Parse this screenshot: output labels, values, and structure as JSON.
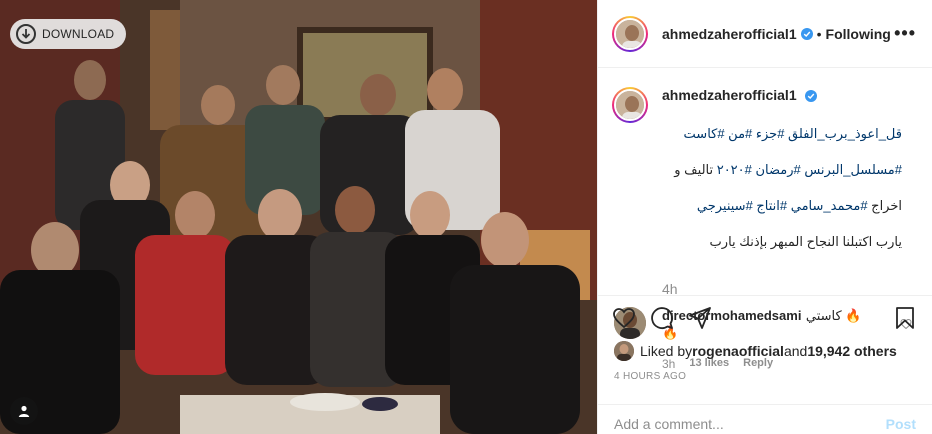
{
  "photo": {
    "download_label": "DOWNLOAD",
    "download_icon": "download-icon",
    "user_tag_icon": "user-tag-icon"
  },
  "header": {
    "username": "ahmedzaherofficial1",
    "separator": "•",
    "follow_status": "Following",
    "more_label": "•••"
  },
  "caption": {
    "username": "ahmedzaherofficial1",
    "line1_a": "قل_اعوذ_برب_الفلق ",
    "line1_tags": "#جزء #من #كاست",
    "line2_tags": "#مسلسل_البرنس #رمضان #٢٠٢٠",
    "line2_b": " تاليف و",
    "line3_a": "اخراج ",
    "line3_tags": "#محمد_سامي #انتاج #سينيرجي",
    "line4": "يارب اكتبلنا النجاح المبهر بإذنك يارب",
    "time": "4h"
  },
  "comment": {
    "username": "directormohamedsami",
    "text": "كاستي 🔥",
    "text2": "🔥",
    "time": "3h",
    "likes": "13 likes",
    "reply": "Reply"
  },
  "likes": {
    "prefix": "Liked by ",
    "user": "rogenaofficial",
    "middle": " and ",
    "count": "19,942 others"
  },
  "post_time": "4 HOURS AGO",
  "add_comment": {
    "placeholder": "Add a comment...",
    "post_label": "Post"
  },
  "colors": {
    "verified": "#3897f0",
    "link": "#00376b",
    "post_disabled": "#b2dffc",
    "muted": "#8e8e8e"
  }
}
